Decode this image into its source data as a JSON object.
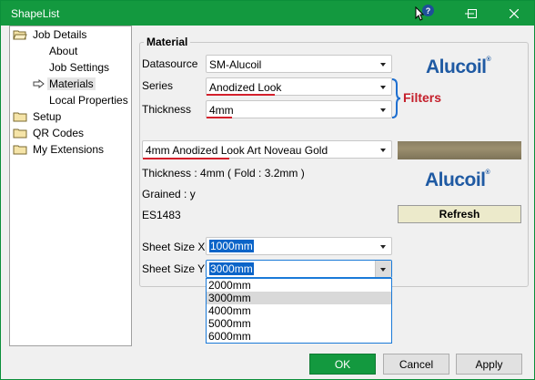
{
  "window": {
    "title": "ShapeList"
  },
  "tree": {
    "items": [
      {
        "label": "Job Details",
        "icon": "folder-open-icon"
      },
      {
        "label": "About"
      },
      {
        "label": "Job Settings"
      },
      {
        "label": "Materials",
        "icon": "arrow-right-icon"
      },
      {
        "label": "Local Properties"
      },
      {
        "label": "Setup",
        "icon": "folder-icon"
      },
      {
        "label": "QR Codes",
        "icon": "folder-icon"
      },
      {
        "label": "My Extensions",
        "icon": "folder-icon"
      }
    ]
  },
  "material": {
    "group_title": "Material",
    "datasource_label": "Datasource",
    "datasource_value": "SM-Alucoil",
    "series_label": "Series",
    "series_value": "Anodized Look",
    "thickness_label": "Thickness",
    "thickness_value": "4mm",
    "filters_label": "Filters",
    "product_value": "4mm Anodized Look Art Noveau Gold",
    "thickness_info": "Thickness : 4mm ( Fold : 3.2mm )",
    "grained_info": "Grained : y",
    "code": "ES1483",
    "brand": "Alucoil",
    "brand_mark": "®",
    "refresh_label": "Refresh",
    "sheet_x_label": "Sheet Size X",
    "sheet_x_value": "1000mm",
    "sheet_y_label": "Sheet Size Y",
    "sheet_y_value": "3000mm",
    "sheet_y_options": [
      "2000mm",
      "3000mm",
      "4000mm",
      "5000mm",
      "6000mm"
    ],
    "sheet_y_selected_index": 1
  },
  "buttons": {
    "ok": "OK",
    "cancel": "Cancel",
    "apply": "Apply"
  },
  "colors": {
    "titlebar": "#13993f",
    "brand": "#1f5aa3",
    "accent_red": "#c41e2a",
    "selection": "#0a64c8"
  }
}
